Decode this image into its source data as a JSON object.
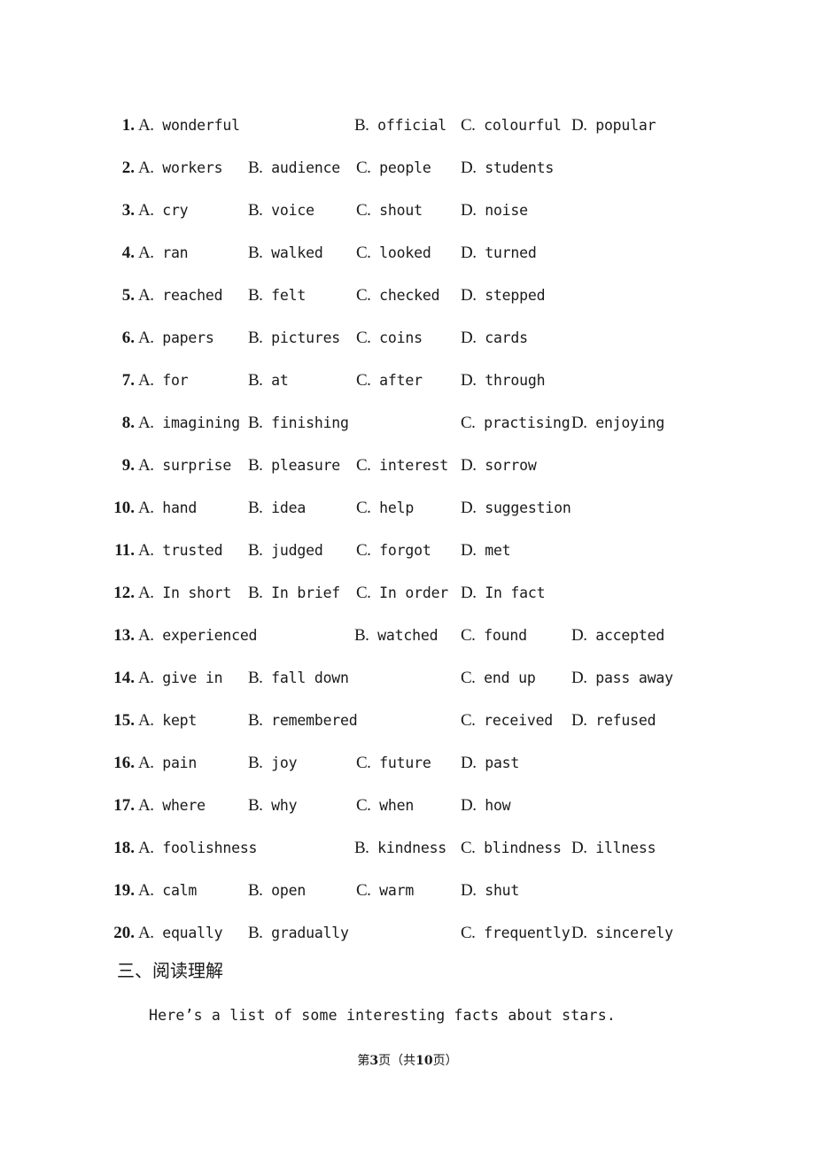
{
  "document": {
    "footer": {
      "prefix": "第",
      "page_number": "3",
      "middle": "页（共",
      "total_pages": "10",
      "suffix": "页）"
    },
    "section_heading": "三、阅读理解",
    "reading_intro": "Here’s a list of some interesting facts about stars."
  },
  "questions": [
    {
      "num": "1.",
      "a": "A. wonderful",
      "b": "B. official",
      "c": "C. colourful",
      "d": "D. popular",
      "cols": [
        "col-a",
        "col-b2",
        "col-c2",
        "col-d2"
      ]
    },
    {
      "num": "2.",
      "a": "A. workers",
      "b": "B. audience",
      "c": "C. people",
      "d": "D. students",
      "cols": [
        "col-a",
        "col-b1",
        "col-c1",
        "col-d1"
      ]
    },
    {
      "num": "3.",
      "a": "A. cry",
      "b": "B. voice",
      "c": "C. shout",
      "d": "D. noise",
      "cols": [
        "col-a",
        "col-b1",
        "col-c1",
        "col-d1"
      ]
    },
    {
      "num": "4.",
      "a": "A. ran",
      "b": "B. walked",
      "c": "C. looked",
      "d": "D. turned",
      "cols": [
        "col-a",
        "col-b1",
        "col-c1",
        "col-d1"
      ]
    },
    {
      "num": "5.",
      "a": "A. reached",
      "b": "B. felt",
      "c": "C. checked",
      "d": "D. stepped",
      "cols": [
        "col-a",
        "col-b1",
        "col-c1",
        "col-d1"
      ]
    },
    {
      "num": "6.",
      "a": "A. papers",
      "b": "B. pictures",
      "c": "C. coins",
      "d": "D. cards",
      "cols": [
        "col-a",
        "col-b1",
        "col-c1",
        "col-d1"
      ]
    },
    {
      "num": "7.",
      "a": "A. for",
      "b": "B. at",
      "c": "C. after",
      "d": "D. through",
      "cols": [
        "col-a",
        "col-b1",
        "col-c1",
        "col-d1"
      ]
    },
    {
      "num": "8.",
      "a": "A. imagining",
      "b": "B. finishing",
      "c": "C. practising",
      "d": "D. enjoying",
      "cols": [
        "col-a",
        "col-b1",
        "col-c2",
        "col-d2"
      ]
    },
    {
      "num": "9.",
      "a": "A. surprise",
      "b": "B. pleasure",
      "c": "C. interest",
      "d": "D. sorrow",
      "cols": [
        "col-a",
        "col-b1",
        "col-c1",
        "col-d1"
      ]
    },
    {
      "num": "10.",
      "a": "A. hand",
      "b": "B. idea",
      "c": "C. help",
      "d": "D. suggestion",
      "cols": [
        "col-a",
        "col-b1",
        "col-c1",
        "col-d1"
      ]
    },
    {
      "num": "11.",
      "a": "A. trusted",
      "b": "B. judged",
      "c": "C. forgot",
      "d": "D. met",
      "cols": [
        "col-a",
        "col-b1",
        "col-c1",
        "col-d1"
      ]
    },
    {
      "num": "12.",
      "a": "A. In short",
      "b": "B. In brief",
      "c": "C. In order",
      "d": "D. In fact",
      "cols": [
        "col-a",
        "col-b1",
        "col-c1",
        "col-d1"
      ]
    },
    {
      "num": "13.",
      "a": "A. experienced",
      "b": "B. watched",
      "c": "C. found",
      "d": "D. accepted",
      "cols": [
        "col-a",
        "col-b2",
        "col-c2",
        "col-d2"
      ]
    },
    {
      "num": "14.",
      "a": "A. give in",
      "b": "B. fall down",
      "c": "C. end up",
      "d": "D. pass away",
      "cols": [
        "col-a",
        "col-b1",
        "col-c2",
        "col-d2"
      ]
    },
    {
      "num": "15.",
      "a": "A. kept",
      "b": "B. remembered",
      "c": "C. received",
      "d": "D. refused",
      "cols": [
        "col-a",
        "col-b1",
        "col-c2",
        "col-d2"
      ]
    },
    {
      "num": "16.",
      "a": "A. pain",
      "b": "B. joy",
      "c": "C. future",
      "d": "D. past",
      "cols": [
        "col-a",
        "col-b1",
        "col-c1",
        "col-d1"
      ]
    },
    {
      "num": "17.",
      "a": "A. where",
      "b": "B. why",
      "c": "C. when",
      "d": "D. how",
      "cols": [
        "col-a",
        "col-b1",
        "col-c1",
        "col-d1"
      ]
    },
    {
      "num": "18.",
      "a": "A. foolishness",
      "b": "B. kindness",
      "c": "C. blindness",
      "d": "D. illness",
      "cols": [
        "col-a",
        "col-b2",
        "col-c2",
        "col-d2"
      ]
    },
    {
      "num": "19.",
      "a": "A. calm",
      "b": "B. open",
      "c": "C. warm",
      "d": "D. shut",
      "cols": [
        "col-a",
        "col-b1",
        "col-c1",
        "col-d1"
      ]
    },
    {
      "num": "20.",
      "a": "A. equally",
      "b": "B. gradually",
      "c": "C. frequently",
      "d": "D. sincerely",
      "cols": [
        "col-a",
        "col-b1",
        "col-c2",
        "col-d2"
      ]
    }
  ]
}
